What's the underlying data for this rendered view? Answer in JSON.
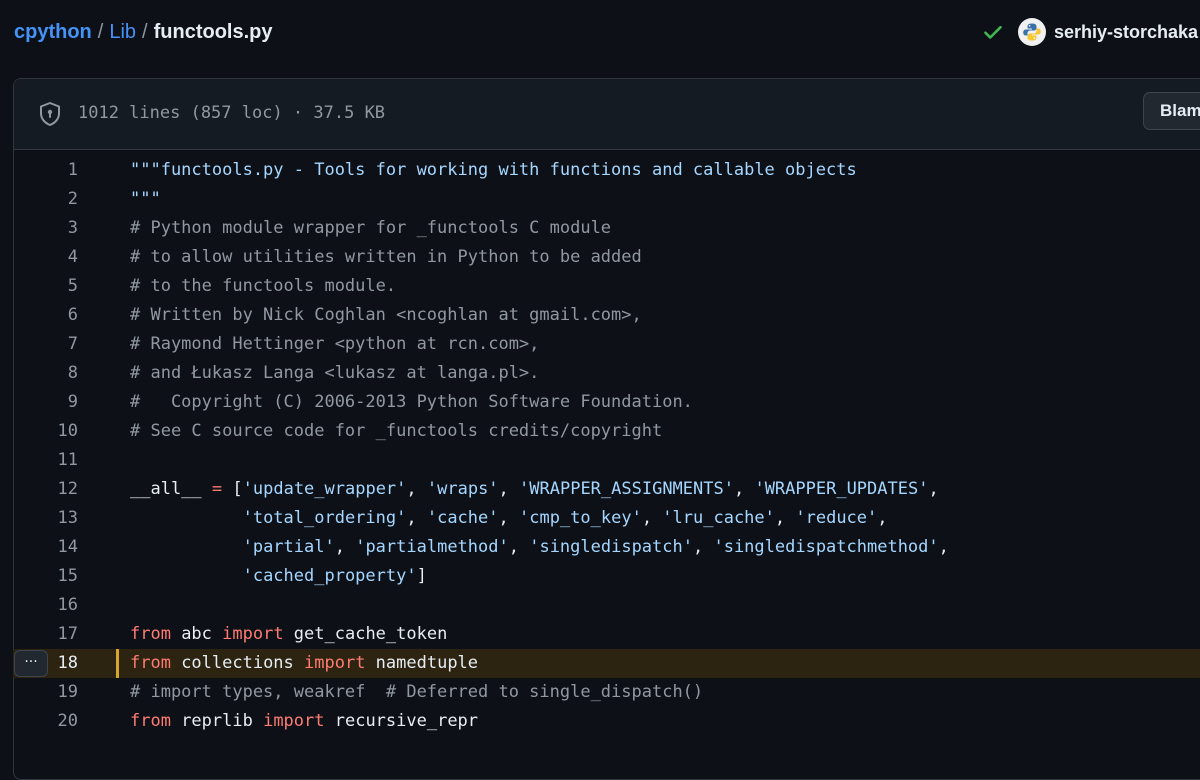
{
  "breadcrumb": {
    "repo": "cpython",
    "folder": "Lib",
    "file": "functools.py",
    "separator": "/"
  },
  "user": {
    "status_icon": "check-icon",
    "avatar_icon": "python-logo-icon",
    "name": "serhiy-storchaka"
  },
  "file_header": {
    "info": "1012 lines (857 loc) · 37.5 KB",
    "blame_label": "Blame"
  },
  "line_actions": {
    "label": "···"
  },
  "colors": {
    "background": "#0d1117",
    "link": "#4493f8",
    "comment": "#9198a1",
    "string": "#a5d6ff",
    "keyword": "#ff7b72",
    "highlight_marker": "#d4a72c"
  },
  "code": {
    "highlighted_line": 18,
    "lines": [
      {
        "n": "1",
        "tokens": [
          {
            "t": "\"\"\"functools.py - Tools for working with functions and callable objects",
            "c": "s"
          }
        ]
      },
      {
        "n": "2",
        "tokens": [
          {
            "t": "\"\"\"",
            "c": "s"
          }
        ]
      },
      {
        "n": "3",
        "tokens": [
          {
            "t": "# Python module wrapper for _functools C module",
            "c": "c"
          }
        ]
      },
      {
        "n": "4",
        "tokens": [
          {
            "t": "# to allow utilities written in Python to be added",
            "c": "c"
          }
        ]
      },
      {
        "n": "5",
        "tokens": [
          {
            "t": "# to the functools module.",
            "c": "c"
          }
        ]
      },
      {
        "n": "6",
        "tokens": [
          {
            "t": "# Written by Nick Coghlan <ncoghlan at gmail.com>,",
            "c": "c"
          }
        ]
      },
      {
        "n": "7",
        "tokens": [
          {
            "t": "# Raymond Hettinger <python at rcn.com>,",
            "c": "c"
          }
        ]
      },
      {
        "n": "8",
        "tokens": [
          {
            "t": "# and Łukasz Langa <lukasz at langa.pl>.",
            "c": "c"
          }
        ]
      },
      {
        "n": "9",
        "tokens": [
          {
            "t": "#   Copyright (C) 2006-2013 Python Software Foundation.",
            "c": "c"
          }
        ]
      },
      {
        "n": "10",
        "tokens": [
          {
            "t": "# See C source code for _functools credits/copyright",
            "c": "c"
          }
        ]
      },
      {
        "n": "11",
        "tokens": []
      },
      {
        "n": "12",
        "tokens": [
          {
            "t": "__all__",
            "c": "n"
          },
          {
            "t": " ",
            "c": "n"
          },
          {
            "t": "=",
            "c": "o"
          },
          {
            "t": " [",
            "c": "n"
          },
          {
            "t": "'update_wrapper'",
            "c": "s"
          },
          {
            "t": ", ",
            "c": "n"
          },
          {
            "t": "'wraps'",
            "c": "s"
          },
          {
            "t": ", ",
            "c": "n"
          },
          {
            "t": "'WRAPPER_ASSIGNMENTS'",
            "c": "s"
          },
          {
            "t": ", ",
            "c": "n"
          },
          {
            "t": "'WRAPPER_UPDATES'",
            "c": "s"
          },
          {
            "t": ",",
            "c": "n"
          }
        ]
      },
      {
        "n": "13",
        "tokens": [
          {
            "t": "           ",
            "c": "n"
          },
          {
            "t": "'total_ordering'",
            "c": "s"
          },
          {
            "t": ", ",
            "c": "n"
          },
          {
            "t": "'cache'",
            "c": "s"
          },
          {
            "t": ", ",
            "c": "n"
          },
          {
            "t": "'cmp_to_key'",
            "c": "s"
          },
          {
            "t": ", ",
            "c": "n"
          },
          {
            "t": "'lru_cache'",
            "c": "s"
          },
          {
            "t": ", ",
            "c": "n"
          },
          {
            "t": "'reduce'",
            "c": "s"
          },
          {
            "t": ",",
            "c": "n"
          }
        ]
      },
      {
        "n": "14",
        "tokens": [
          {
            "t": "           ",
            "c": "n"
          },
          {
            "t": "'partial'",
            "c": "s"
          },
          {
            "t": ", ",
            "c": "n"
          },
          {
            "t": "'partialmethod'",
            "c": "s"
          },
          {
            "t": ", ",
            "c": "n"
          },
          {
            "t": "'singledispatch'",
            "c": "s"
          },
          {
            "t": ", ",
            "c": "n"
          },
          {
            "t": "'singledispatchmethod'",
            "c": "s"
          },
          {
            "t": ",",
            "c": "n"
          }
        ]
      },
      {
        "n": "15",
        "tokens": [
          {
            "t": "           ",
            "c": "n"
          },
          {
            "t": "'cached_property'",
            "c": "s"
          },
          {
            "t": "]",
            "c": "n"
          }
        ]
      },
      {
        "n": "16",
        "tokens": []
      },
      {
        "n": "17",
        "tokens": [
          {
            "t": "from",
            "c": "k"
          },
          {
            "t": " abc ",
            "c": "n"
          },
          {
            "t": "import",
            "c": "k"
          },
          {
            "t": " get_cache_token",
            "c": "n"
          }
        ]
      },
      {
        "n": "18",
        "tokens": [
          {
            "t": "from",
            "c": "k"
          },
          {
            "t": " collections ",
            "c": "n"
          },
          {
            "t": "import",
            "c": "k"
          },
          {
            "t": " namedtuple",
            "c": "n"
          }
        ]
      },
      {
        "n": "19",
        "tokens": [
          {
            "t": "# import types, weakref  # Deferred to single_dispatch()",
            "c": "c"
          }
        ]
      },
      {
        "n": "20",
        "tokens": [
          {
            "t": "from",
            "c": "k"
          },
          {
            "t": " reprlib ",
            "c": "n"
          },
          {
            "t": "import",
            "c": "k"
          },
          {
            "t": " recursive_repr",
            "c": "n"
          }
        ]
      }
    ]
  }
}
